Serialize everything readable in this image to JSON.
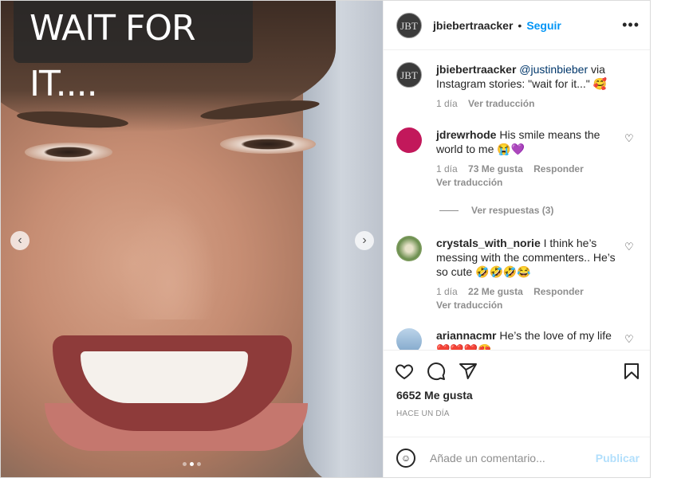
{
  "media": {
    "caption": "WAIT FOR IT....",
    "prev_icon": "chevron-left-icon",
    "next_icon": "chevron-right-icon",
    "slides": 3,
    "active_slide": 2
  },
  "header": {
    "avatar_text": "JBT",
    "username": "jbiebertraacker",
    "separator": "•",
    "follow": "Seguir",
    "more": "•••"
  },
  "post": {
    "username": "jbiebertraacker",
    "mention": "@justinbieber",
    "text": " via Instagram stories: \"wait for it...\" 🥰",
    "age": "1 día",
    "translate": "Ver traducción"
  },
  "comments": [
    {
      "username": "jdrewrhode",
      "text": " His smile means the world to me 😭💜",
      "age": "1 día",
      "likes": "73 Me gusta",
      "reply": "Responder",
      "translate": "Ver traducción",
      "avatar_color": "#c2185b"
    },
    {
      "username": "crystals_with_norie",
      "text": " I think he’s messing with the commenters.. He’s so cute 🤣🤣🤣😂",
      "age": "1 día",
      "likes": "22 Me gusta",
      "reply": "Responder",
      "translate": "Ver traducción",
      "avatar_color": "#6b8e4e"
    },
    {
      "username": "ariannacmr",
      "text": " He’s the love of my life ❤️❤️❤️😍",
      "avatar_color": "#7fa6c9"
    }
  ],
  "replies_label": "Ver respuestas (3)",
  "likes": "6652 Me gusta",
  "timestamp": "HACE UN DÍA",
  "add_comment": {
    "placeholder": "Añade un comentario...",
    "publish": "Publicar"
  },
  "colors": {
    "accent": "#0095f6",
    "publish_disabled": "#b2dffc"
  }
}
